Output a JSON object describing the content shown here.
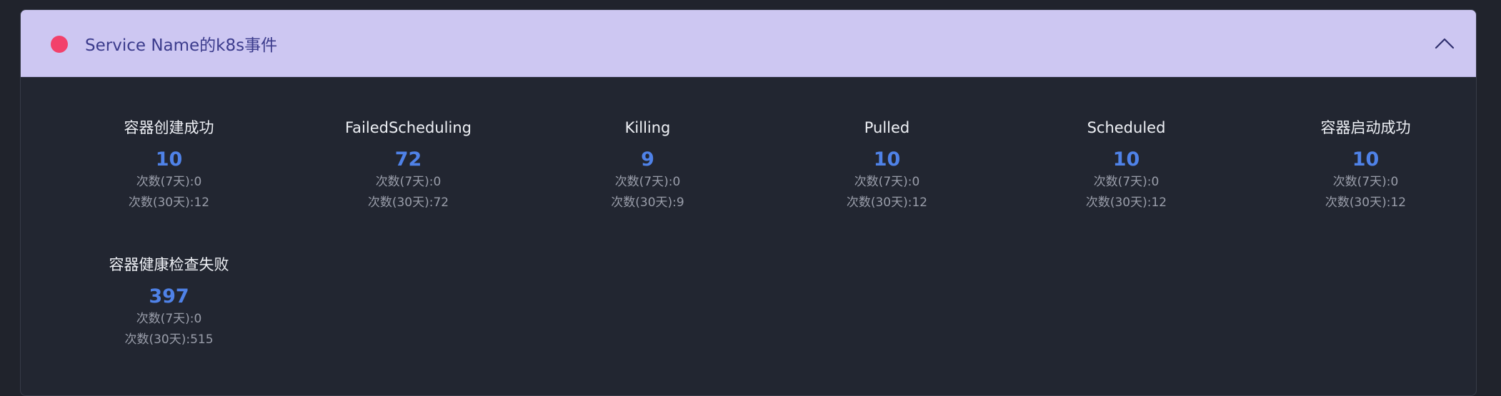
{
  "panel": {
    "title": "Service Name的k8s事件",
    "status_color": "#f2416b",
    "collapse_icon": "chevron-up-icon"
  },
  "events": [
    {
      "label": "容器创建成功",
      "value": "10",
      "week": "次数(7天):0",
      "month": "次数(30天):12"
    },
    {
      "label": "FailedScheduling",
      "value": "72",
      "week": "次数(7天):0",
      "month": "次数(30天):72"
    },
    {
      "label": "Killing",
      "value": "9",
      "week": "次数(7天):0",
      "month": "次数(30天):9"
    },
    {
      "label": "Pulled",
      "value": "10",
      "week": "次数(7天):0",
      "month": "次数(30天):12"
    },
    {
      "label": "Scheduled",
      "value": "10",
      "week": "次数(7天):0",
      "month": "次数(30天):12"
    },
    {
      "label": "容器启动成功",
      "value": "10",
      "week": "次数(7天):0",
      "month": "次数(30天):12"
    },
    {
      "label": "容器健康检查失败",
      "value": "397",
      "week": "次数(7天):0",
      "month": "次数(30天):515"
    }
  ],
  "colors": {
    "accent": "#4f82e8",
    "header_bg": "#cdc7f2",
    "panel_bg": "#222631"
  }
}
